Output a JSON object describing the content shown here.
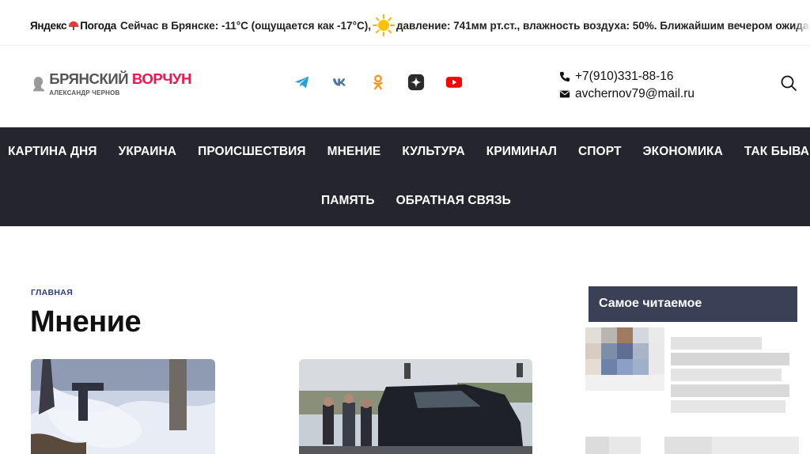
{
  "ticker": {
    "brand": "Яндекс",
    "brand2": "Погода",
    "text1": "Сейчас в Брянске: -11°C (ощущается как -17°C),",
    "text2": "давление: 741мм рт.ст., влажность воздуха: 50%. Ближайшим вечером ожидается"
  },
  "header": {
    "logo_title_1": "БРЯНСКИЙ",
    "logo_title_2": "ВОРЧУН",
    "logo_subtitle": "АЛЕКСАНДР ЧЕРНОВ",
    "socials": [
      "telegram-icon",
      "vk-icon",
      "odnoklassniki-icon",
      "zen-icon",
      "youtube-icon"
    ],
    "phone": "+7(910)331-88-16",
    "email": "avchernov79@mail.ru"
  },
  "nav": {
    "row1": [
      "КАРТИНА ДНЯ",
      "УКРАИНА",
      "ПРОИСШЕСТВИЯ",
      "МНЕНИЕ",
      "КУЛЬТУРА",
      "КРИМИНАЛ",
      "СПОРТ",
      "ЭКОНОМИКА",
      "ТАК БЫВАЕТ"
    ],
    "row2": [
      "ПАМЯТЬ",
      "ОБРАТНАЯ СВЯЗЬ"
    ]
  },
  "main": {
    "breadcrumb": "ГЛАВНАЯ",
    "title": "Мнение"
  },
  "sidebar": {
    "title": "Самое читаемое"
  },
  "colors": {
    "nav_bg": "#25252d",
    "brand_red": "#e8194b",
    "sidebar_head": "#3a4157",
    "breadcrumb": "#2b3a8c"
  }
}
